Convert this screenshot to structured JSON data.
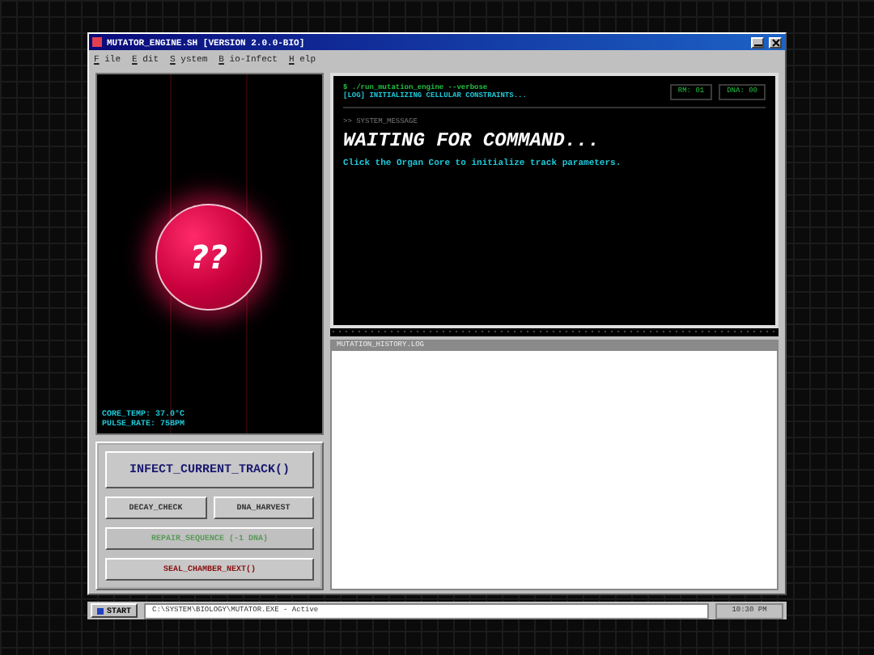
{
  "window": {
    "title": "MUTATOR_ENGINE.SH [VERSION 2.0.0-BIO]"
  },
  "menu": [
    {
      "key": "F",
      "rest": "ile"
    },
    {
      "key": "E",
      "rest": "dit"
    },
    {
      "key": "S",
      "rest": "ystem"
    },
    {
      "key": "B",
      "rest": "io-Infect"
    },
    {
      "key": "H",
      "rest": "elp"
    }
  ],
  "core": {
    "label": "??",
    "readouts": [
      "CORE_TEMP: 37.0°C",
      "PULSE_RATE: 75BPM"
    ]
  },
  "controls": [
    {
      "label": "INFECT_CURRENT_TRACK()",
      "kind": "primary",
      "disabled": false
    },
    {
      "label": "DECAY_CHECK",
      "kind": "half",
      "disabled": false
    },
    {
      "label": "DNA_HARVEST",
      "kind": "half",
      "disabled": false
    },
    {
      "label": "REPAIR_SEQUENCE (-1 DNA)",
      "kind": "full",
      "disabled": true
    },
    {
      "label": "SEAL_CHAMBER_NEXT()",
      "kind": "danger",
      "disabled": false
    }
  ],
  "terminal": {
    "lines": [
      "$ ./run_mutation_engine --verbose",
      "[LOG] INITIALIZING CELLULAR CONSTRAINTS..."
    ],
    "counters": [
      "RM: 01",
      "DNA: 00"
    ],
    "section": ">> SYSTEM_MESSAGE",
    "headline": "WAITING FOR COMMAND...",
    "message": "Click the Organ Core to initialize track parameters."
  },
  "log": {
    "title": "MUTATION_HISTORY.LOG"
  },
  "taskbar": {
    "start": "START",
    "path": "C:\\SYSTEM\\BIOLOGY\\MUTATOR.EXE - Active",
    "clock": "10:30 PM"
  }
}
